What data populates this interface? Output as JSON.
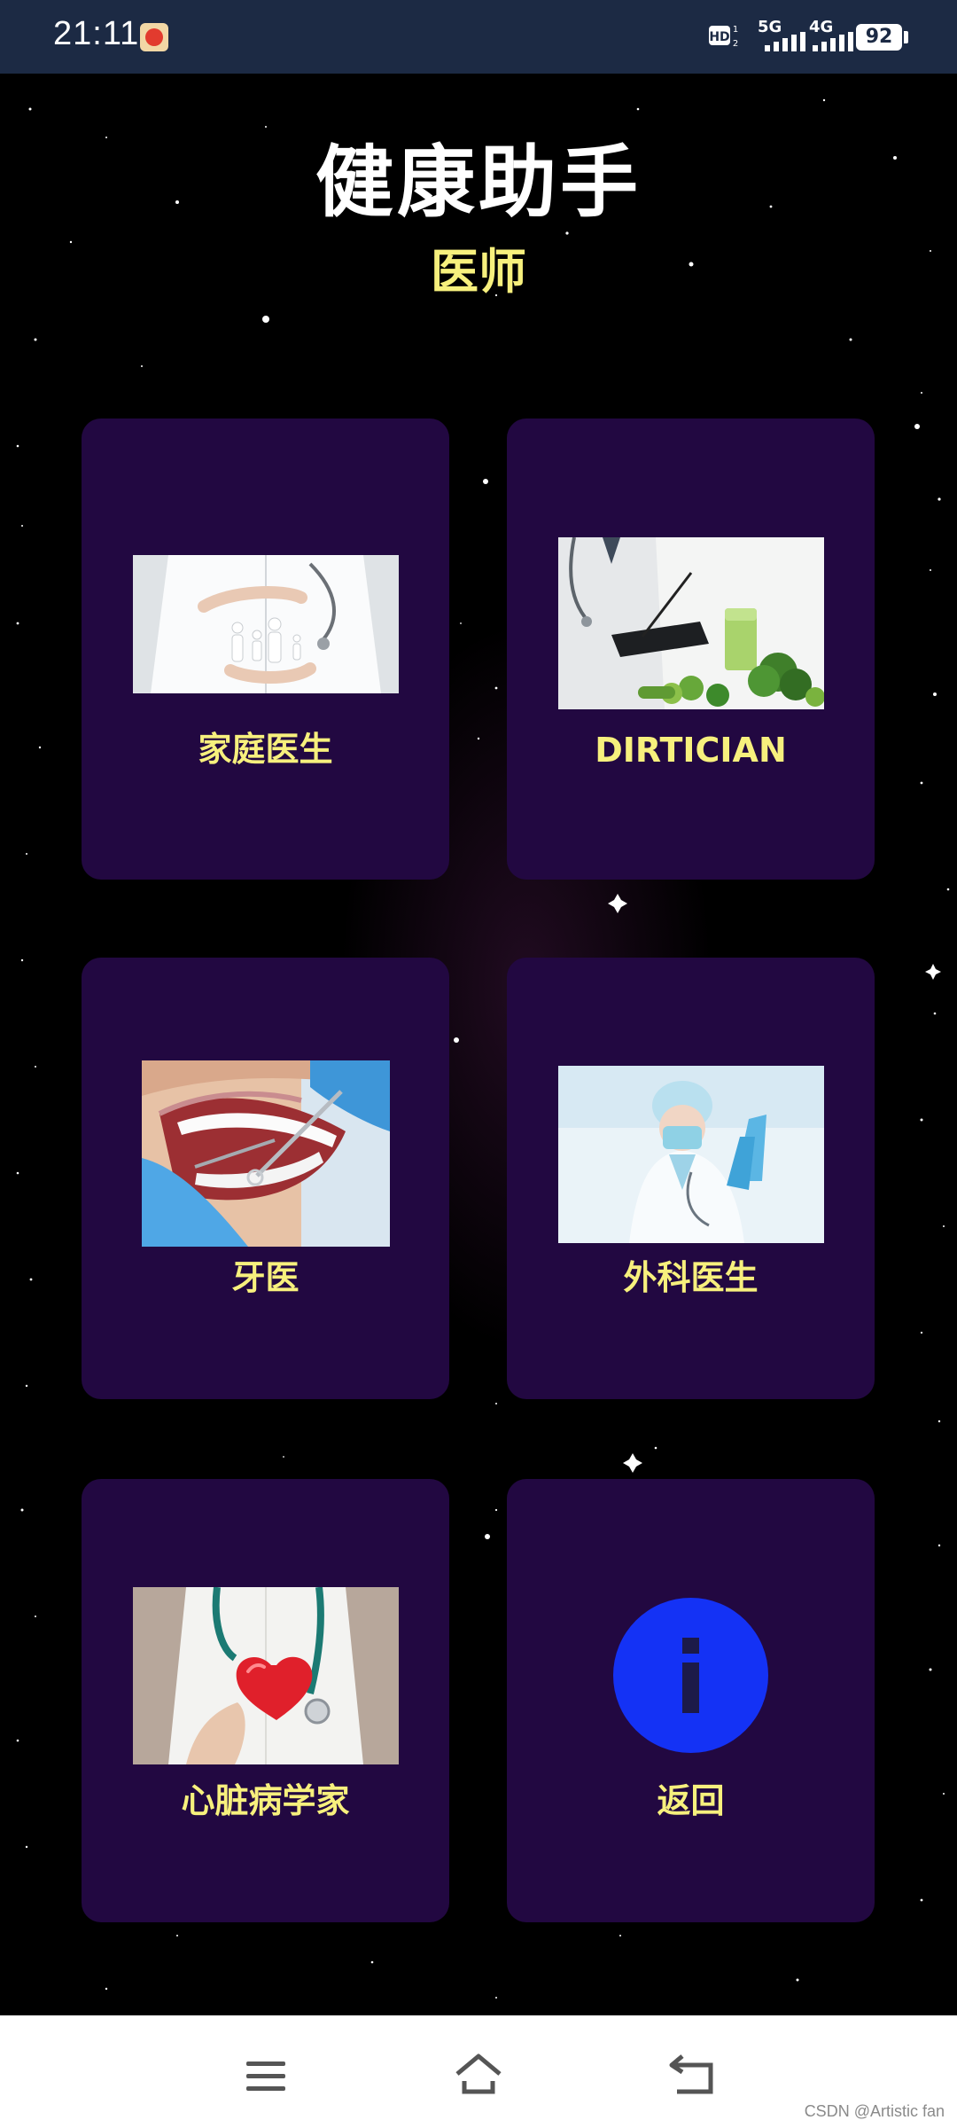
{
  "status_bar": {
    "time": "21:11",
    "app_icon": "tomato-icon",
    "hd_icon": "hd-voice-icon",
    "network_1": "5G",
    "network_2": "4G",
    "battery": "92"
  },
  "header": {
    "title": "健康助手",
    "subtitle": "医师"
  },
  "cards": [
    {
      "label": "家庭医生",
      "image": "family-doctor-photo"
    },
    {
      "label": "DIRTICIAN",
      "image": "dietician-photo"
    },
    {
      "label": "牙医",
      "image": "dentist-photo"
    },
    {
      "label": "外科医生",
      "image": "surgeon-photo"
    },
    {
      "label": "心脏病学家",
      "image": "cardiologist-photo"
    },
    {
      "label": "返回",
      "image": "info-icon"
    }
  ],
  "nav_bar": {
    "items": [
      "menu-icon",
      "home-icon",
      "back-icon"
    ]
  },
  "watermark": "CSDN @Artistic fan",
  "colors": {
    "status_bar": "#1c2a44",
    "background": "#000000",
    "card": "#220841",
    "label": "#f7f07d",
    "title": "#ffffff",
    "info_circle": "#1432f5"
  }
}
